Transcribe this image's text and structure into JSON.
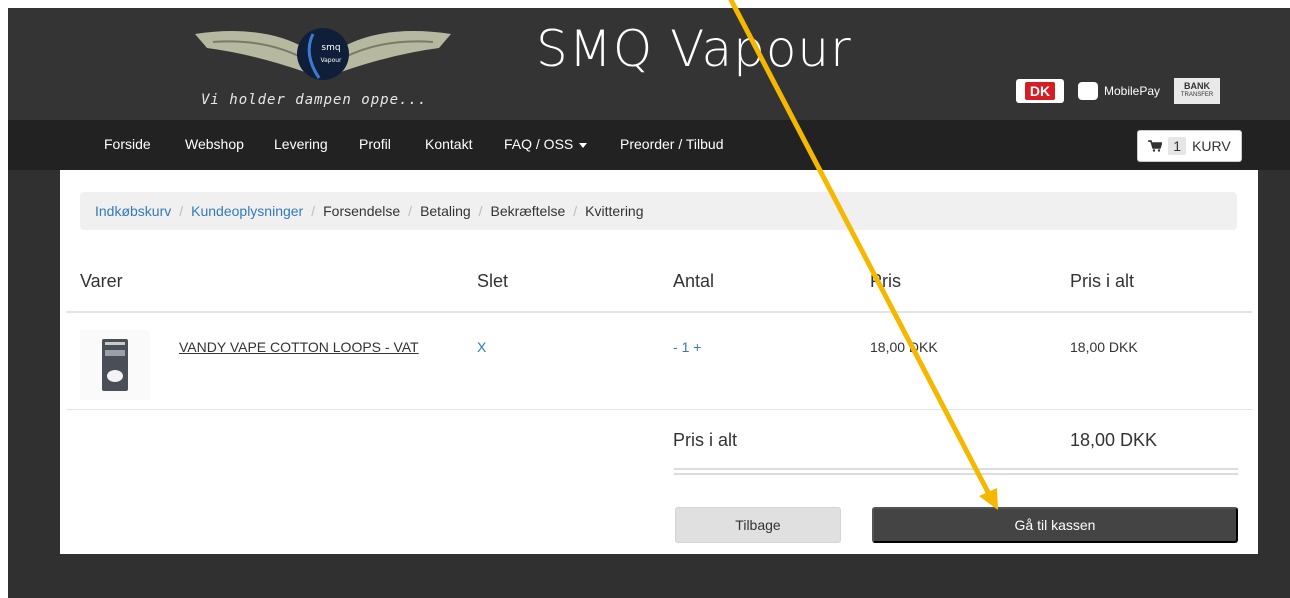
{
  "header": {
    "site_title": "SMQ Vapour",
    "tagline": "Vi holder dampen oppe...",
    "logo_text_top": "smq",
    "logo_text_bottom": "Vapour",
    "payment": {
      "dk": "DK",
      "mobilepay": "MobilePay",
      "bank_line1": "BANK",
      "bank_line2": "TRANSFER"
    }
  },
  "nav": {
    "items": [
      "Forside",
      "Webshop",
      "Levering",
      "Profil",
      "Kontakt",
      "FAQ / OSS",
      "Preorder / Tilbud"
    ],
    "cart_count": "1",
    "cart_label": "KURV"
  },
  "breadcrumb": {
    "steps": [
      "Indkøbskurv",
      "Kundeoplysninger",
      "Forsendelse",
      "Betaling",
      "Bekræftelse",
      "Kvittering"
    ]
  },
  "cart": {
    "columns": [
      "Varer",
      "Slet",
      "Antal",
      "Pris",
      "Pris i alt"
    ],
    "items": [
      {
        "name": "VANDY VAPE COTTON LOOPS - VAT",
        "delete": "X",
        "qty_minus": "-",
        "qty": "1",
        "qty_plus": "+",
        "price": "18,00 DKK",
        "total": "18,00 DKK"
      }
    ],
    "total_label": "Pris i alt",
    "total_value": "18,00 DKK"
  },
  "actions": {
    "back_label": "Tilbage",
    "checkout_label": "Gå til kassen"
  },
  "colors": {
    "link": "#337ab7",
    "annotation_arrow": "#f5b800",
    "checkout_button": "#444444"
  }
}
